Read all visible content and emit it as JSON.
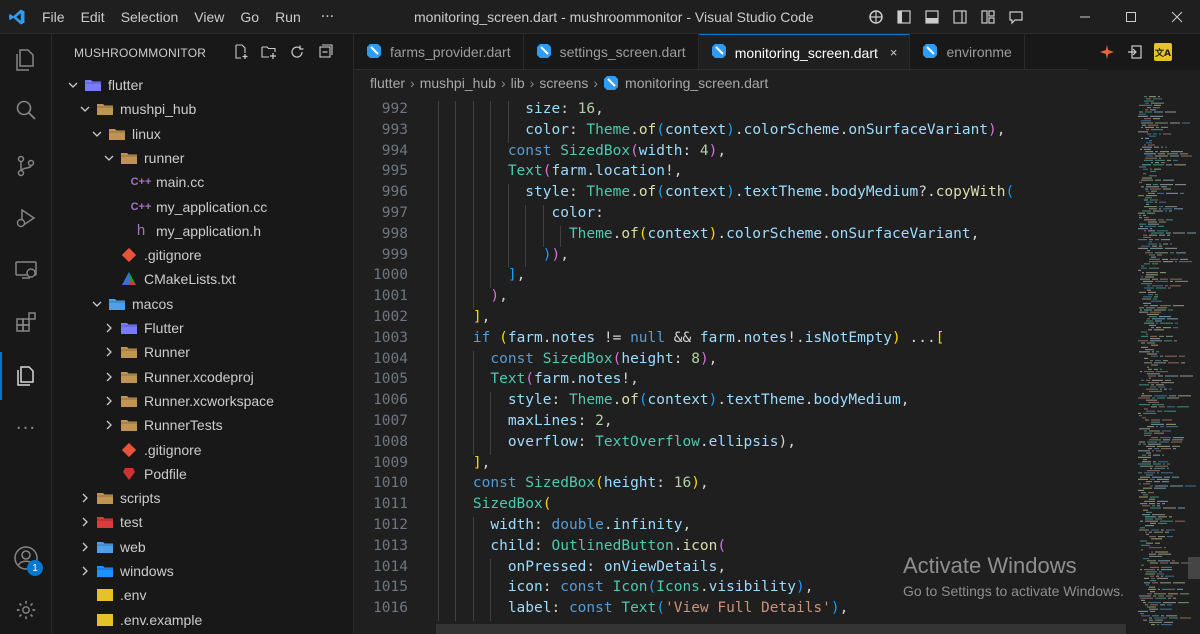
{
  "titlebar": {
    "menu": [
      "File",
      "Edit",
      "Selection",
      "View",
      "Go",
      "Run"
    ],
    "more": "···",
    "window_title": "monitoring_screen.dart - mushroommonitor - Visual Studio Code",
    "layout_icons": [
      "copilot-icon",
      "toggle-primary-sidebar-icon",
      "toggle-panel-icon",
      "toggle-secondary-sidebar-icon",
      "customize-layout-icon",
      "feedback-icon"
    ],
    "colors": {
      "accent": "#0078d4",
      "logo": "#2f9cf3"
    }
  },
  "activitybar": {
    "items": [
      "explorer-icon",
      "search-icon",
      "source-control-icon",
      "run-debug-icon",
      "remote-explorer-icon",
      "extensions-icon",
      "files-icon",
      "more-icon"
    ],
    "account_badge": "1"
  },
  "sidebar": {
    "title": "MUSHROOMMONITOR",
    "tree": [
      {
        "label": "flutter",
        "depth": 0,
        "chevron": "down",
        "icon": "folder-flutter",
        "color": "#7a7aff"
      },
      {
        "label": "mushpi_hub",
        "depth": 1,
        "chevron": "down",
        "icon": "folder-open",
        "color": "#c09553"
      },
      {
        "label": "linux",
        "depth": 2,
        "chevron": "down",
        "icon": "folder-linux",
        "color": "#c09553"
      },
      {
        "label": "runner",
        "depth": 3,
        "chevron": "down",
        "icon": "folder-open",
        "color": "#c09553"
      },
      {
        "label": "main.cc",
        "depth": 4,
        "chevron": "",
        "icon": "cpp",
        "color": "#a074c4"
      },
      {
        "label": "my_application.cc",
        "depth": 4,
        "chevron": "",
        "icon": "cpp",
        "color": "#a074c4"
      },
      {
        "label": "my_application.h",
        "depth": 4,
        "chevron": "",
        "icon": "header",
        "color": "#a074c4"
      },
      {
        "label": ".gitignore",
        "depth": 3,
        "chevron": "",
        "icon": "git",
        "color": "#e8533c"
      },
      {
        "label": "CMakeLists.txt",
        "depth": 3,
        "chevron": "",
        "icon": "cmake",
        "color": "#0e9f3e"
      },
      {
        "label": "macos",
        "depth": 2,
        "chevron": "down",
        "icon": "folder-mac",
        "color": "#4fa0e8"
      },
      {
        "label": "Flutter",
        "depth": 3,
        "chevron": "right",
        "icon": "folder-flutter",
        "color": "#7a7aff"
      },
      {
        "label": "Runner",
        "depth": 3,
        "chevron": "right",
        "icon": "folder",
        "color": "#c09553"
      },
      {
        "label": "Runner.xcodeproj",
        "depth": 3,
        "chevron": "right",
        "icon": "folder",
        "color": "#c09553"
      },
      {
        "label": "Runner.xcworkspace",
        "depth": 3,
        "chevron": "right",
        "icon": "folder",
        "color": "#c09553"
      },
      {
        "label": "RunnerTests",
        "depth": 3,
        "chevron": "right",
        "icon": "folder",
        "color": "#c09553"
      },
      {
        "label": ".gitignore",
        "depth": 3,
        "chevron": "",
        "icon": "git",
        "color": "#e8533c"
      },
      {
        "label": "Podfile",
        "depth": 3,
        "chevron": "",
        "icon": "ruby",
        "color": "#cc3333"
      },
      {
        "label": "scripts",
        "depth": 1,
        "chevron": "right",
        "icon": "folder-scripts",
        "color": "#c09553"
      },
      {
        "label": "test",
        "depth": 1,
        "chevron": "right",
        "icon": "folder-test",
        "color": "#d83c3c"
      },
      {
        "label": "web",
        "depth": 1,
        "chevron": "right",
        "icon": "folder-web",
        "color": "#4fa0e8"
      },
      {
        "label": "windows",
        "depth": 1,
        "chevron": "right",
        "icon": "folder-windows",
        "color": "#1e90ff"
      },
      {
        "label": ".env",
        "depth": 1,
        "chevron": "",
        "icon": "env",
        "color": "#e6c229"
      },
      {
        "label": ".env.example",
        "depth": 1,
        "chevron": "",
        "icon": "env",
        "color": "#e6c229"
      }
    ]
  },
  "tabs": [
    {
      "label": "farms_provider.dart",
      "active": false
    },
    {
      "label": "settings_screen.dart",
      "active": false
    },
    {
      "label": "monitoring_screen.dart",
      "active": true,
      "close": "×"
    },
    {
      "label": "environme",
      "active": false
    }
  ],
  "breadcrumb": [
    "flutter",
    "mushpi_hub",
    "lib",
    "screens",
    "monitoring_screen.dart"
  ],
  "breadcrumb_sep": "›",
  "editor": {
    "lines": [
      {
        "n": "992",
        "indent": 10,
        "tokens": [
          [
            "var",
            "size"
          ],
          [
            "op",
            ": "
          ],
          [
            "num",
            "16"
          ],
          [
            "op",
            ","
          ]
        ]
      },
      {
        "n": "993",
        "indent": 10,
        "tokens": [
          [
            "var",
            "color"
          ],
          [
            "op",
            ": "
          ],
          [
            "cls",
            "Theme"
          ],
          [
            "op",
            "."
          ],
          [
            "fn",
            "of"
          ],
          [
            "p3",
            "("
          ],
          [
            "var",
            "context"
          ],
          [
            "p3",
            ")"
          ],
          [
            "op",
            "."
          ],
          [
            "var",
            "colorScheme"
          ],
          [
            "op",
            "."
          ],
          [
            "var",
            "onSurfaceVariant"
          ],
          [
            "p2",
            ")"
          ],
          [
            "op",
            ","
          ]
        ]
      },
      {
        "n": "994",
        "indent": 8,
        "tokens": [
          [
            "kw",
            "const "
          ],
          [
            "cls",
            "SizedBox"
          ],
          [
            "p2",
            "("
          ],
          [
            "var",
            "width"
          ],
          [
            "op",
            ": "
          ],
          [
            "num",
            "4"
          ],
          [
            "p2",
            ")"
          ],
          [
            "op",
            ","
          ]
        ]
      },
      {
        "n": "995",
        "indent": 8,
        "tokens": [
          [
            "cls",
            "Text"
          ],
          [
            "p2",
            "("
          ],
          [
            "var",
            "farm"
          ],
          [
            "op",
            "."
          ],
          [
            "var",
            "location"
          ],
          [
            "op",
            "!,"
          ]
        ]
      },
      {
        "n": "996",
        "indent": 10,
        "tokens": [
          [
            "var",
            "style"
          ],
          [
            "op",
            ": "
          ],
          [
            "cls",
            "Theme"
          ],
          [
            "op",
            "."
          ],
          [
            "fn",
            "of"
          ],
          [
            "p3",
            "("
          ],
          [
            "var",
            "context"
          ],
          [
            "p3",
            ")"
          ],
          [
            "op",
            "."
          ],
          [
            "var",
            "textTheme"
          ],
          [
            "op",
            "."
          ],
          [
            "var",
            "bodyMedium"
          ],
          [
            "op",
            "?."
          ],
          [
            "fn",
            "copyWith"
          ],
          [
            "p3",
            "("
          ]
        ]
      },
      {
        "n": "997",
        "indent": 13,
        "tokens": [
          [
            "var",
            "color"
          ],
          [
            "op",
            ":"
          ]
        ]
      },
      {
        "n": "998",
        "indent": 15,
        "tokens": [
          [
            "cls",
            "Theme"
          ],
          [
            "op",
            "."
          ],
          [
            "fn",
            "of"
          ],
          [
            "p1",
            "("
          ],
          [
            "var",
            "context"
          ],
          [
            "p1",
            ")"
          ],
          [
            "op",
            "."
          ],
          [
            "var",
            "colorScheme"
          ],
          [
            "op",
            "."
          ],
          [
            "var",
            "onSurfaceVariant"
          ],
          [
            "op",
            ","
          ]
        ]
      },
      {
        "n": "999",
        "indent": 12,
        "tokens": [
          [
            "p3",
            ")"
          ],
          [
            "p2",
            ")"
          ],
          [
            "op",
            ","
          ]
        ]
      },
      {
        "n": "1000",
        "indent": 8,
        "tokens": [
          [
            "p3",
            "]"
          ],
          [
            "op",
            ","
          ]
        ]
      },
      {
        "n": "1001",
        "indent": 6,
        "tokens": [
          [
            "p2",
            ")"
          ],
          [
            "op",
            ","
          ]
        ]
      },
      {
        "n": "1002",
        "indent": 4,
        "tokens": [
          [
            "p1",
            "]"
          ],
          [
            "op",
            ","
          ]
        ]
      },
      {
        "n": "1003",
        "indent": 4,
        "tokens": [
          [
            "kw",
            "if "
          ],
          [
            "p1",
            "("
          ],
          [
            "var",
            "farm"
          ],
          [
            "op",
            "."
          ],
          [
            "var",
            "notes"
          ],
          [
            "op",
            " != "
          ],
          [
            "kw",
            "null"
          ],
          [
            "op",
            " && "
          ],
          [
            "var",
            "farm"
          ],
          [
            "op",
            "."
          ],
          [
            "var",
            "notes"
          ],
          [
            "op",
            "!."
          ],
          [
            "var",
            "isNotEmpty"
          ],
          [
            "p1",
            ")"
          ],
          [
            "op",
            " ..."
          ],
          [
            "p1",
            "["
          ]
        ]
      },
      {
        "n": "1004",
        "indent": 6,
        "tokens": [
          [
            "kw",
            "const "
          ],
          [
            "cls",
            "SizedBox"
          ],
          [
            "p2",
            "("
          ],
          [
            "var",
            "height"
          ],
          [
            "op",
            ": "
          ],
          [
            "num",
            "8"
          ],
          [
            "p2",
            ")"
          ],
          [
            "op",
            ","
          ]
        ]
      },
      {
        "n": "1005",
        "indent": 6,
        "tokens": [
          [
            "cls",
            "Text"
          ],
          [
            "p2",
            "("
          ],
          [
            "var",
            "farm"
          ],
          [
            "op",
            "."
          ],
          [
            "var",
            "notes"
          ],
          [
            "op",
            "!,"
          ]
        ]
      },
      {
        "n": "1006",
        "indent": 8,
        "tokens": [
          [
            "var",
            "style"
          ],
          [
            "op",
            ": "
          ],
          [
            "cls",
            "Theme"
          ],
          [
            "op",
            "."
          ],
          [
            "fn",
            "of"
          ],
          [
            "p3",
            "("
          ],
          [
            "var",
            "context"
          ],
          [
            "p3",
            ")"
          ],
          [
            "op",
            "."
          ],
          [
            "var",
            "textTheme"
          ],
          [
            "op",
            "."
          ],
          [
            "var",
            "bodyMedium"
          ],
          [
            "op",
            ","
          ]
        ]
      },
      {
        "n": "1007",
        "indent": 8,
        "tokens": [
          [
            "var",
            "maxLines"
          ],
          [
            "op",
            ": "
          ],
          [
            "num",
            "2"
          ],
          [
            "op",
            ","
          ]
        ]
      },
      {
        "n": "1008",
        "indent": 8,
        "tokens": [
          [
            "var",
            "overflow"
          ],
          [
            "op",
            ": "
          ],
          [
            "cls",
            "TextOverflow"
          ],
          [
            "op",
            "."
          ],
          [
            "var",
            "ellipsis"
          ],
          [
            "op",
            "),"
          ]
        ]
      },
      {
        "n": "1009",
        "indent": 4,
        "tokens": [
          [
            "p1",
            "]"
          ],
          [
            "op",
            ","
          ]
        ]
      },
      {
        "n": "1010",
        "indent": 4,
        "tokens": [
          [
            "kw",
            "const "
          ],
          [
            "cls",
            "SizedBox"
          ],
          [
            "p1",
            "("
          ],
          [
            "var",
            "height"
          ],
          [
            "op",
            ": "
          ],
          [
            "num",
            "16"
          ],
          [
            "p1",
            ")"
          ],
          [
            "op",
            ","
          ]
        ]
      },
      {
        "n": "1011",
        "indent": 4,
        "tokens": [
          [
            "cls",
            "SizedBox"
          ],
          [
            "p1",
            "("
          ]
        ]
      },
      {
        "n": "1012",
        "indent": 6,
        "tokens": [
          [
            "var",
            "width"
          ],
          [
            "op",
            ": "
          ],
          [
            "kw",
            "double"
          ],
          [
            "op",
            "."
          ],
          [
            "var",
            "infinity"
          ],
          [
            "op",
            ","
          ]
        ]
      },
      {
        "n": "1013",
        "indent": 6,
        "tokens": [
          [
            "var",
            "child"
          ],
          [
            "op",
            ": "
          ],
          [
            "cls",
            "OutlinedButton"
          ],
          [
            "op",
            "."
          ],
          [
            "fn",
            "icon"
          ],
          [
            "p2",
            "("
          ]
        ]
      },
      {
        "n": "1014",
        "indent": 8,
        "tokens": [
          [
            "var",
            "onPressed"
          ],
          [
            "op",
            ": "
          ],
          [
            "var",
            "onViewDetails"
          ],
          [
            "op",
            ","
          ]
        ]
      },
      {
        "n": "1015",
        "indent": 8,
        "tokens": [
          [
            "var",
            "icon"
          ],
          [
            "op",
            ": "
          ],
          [
            "kw",
            "const "
          ],
          [
            "cls",
            "Icon"
          ],
          [
            "p3",
            "("
          ],
          [
            "cls",
            "Icons"
          ],
          [
            "op",
            "."
          ],
          [
            "var",
            "visibility"
          ],
          [
            "p3",
            ")"
          ],
          [
            "op",
            ","
          ]
        ]
      },
      {
        "n": "1016",
        "indent": 8,
        "tokens": [
          [
            "var",
            "label"
          ],
          [
            "op",
            ": "
          ],
          [
            "kw",
            "const "
          ],
          [
            "cls",
            "Text"
          ],
          [
            "p3",
            "("
          ],
          [
            "str",
            "'View Full Details'"
          ],
          [
            "p3",
            ")"
          ],
          [
            "op",
            ","
          ]
        ]
      }
    ]
  },
  "watermark": {
    "title": "Activate Windows",
    "subtitle": "Go to Settings to activate Windows."
  }
}
